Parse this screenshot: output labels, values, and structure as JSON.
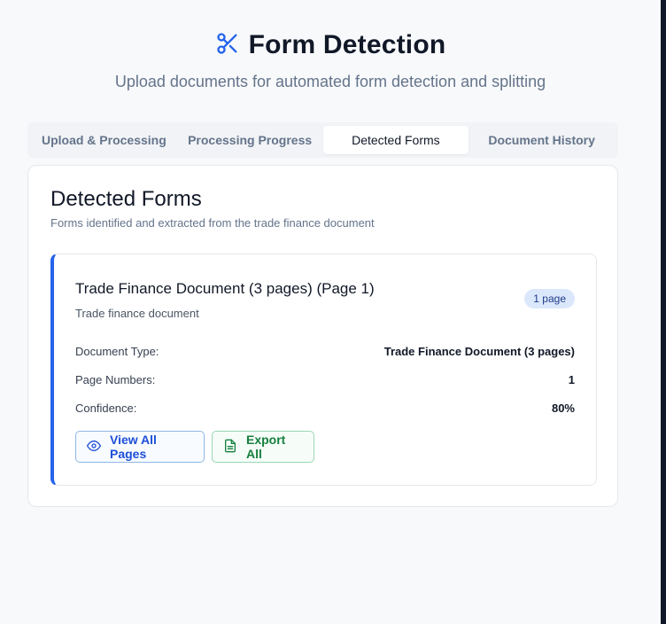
{
  "header": {
    "title": "Form Detection",
    "subtitle": "Upload documents for automated form detection and splitting",
    "icon": "scissors-icon",
    "accent": "#2563eb"
  },
  "tabs": [
    {
      "label": "Upload & Processing",
      "active": false
    },
    {
      "label": "Processing Progress",
      "active": false
    },
    {
      "label": "Detected Forms",
      "active": true
    },
    {
      "label": "Document History",
      "active": false
    }
  ],
  "panel": {
    "title": "Detected Forms",
    "description": "Forms identified and extracted from the trade finance document"
  },
  "form_card": {
    "title": "Trade Finance Document (3 pages) (Page 1)",
    "subtitle": "Trade finance document",
    "badge": "1 page",
    "fields": [
      {
        "label": "Document Type:",
        "value": "Trade Finance Document (3 pages)"
      },
      {
        "label": "Page Numbers:",
        "value": "1"
      },
      {
        "label": "Confidence:",
        "value": "80%"
      }
    ],
    "buttons": {
      "view_label": "View All Pages",
      "view_icon": "eye-icon",
      "export_label": "Export All",
      "export_icon": "file-icon"
    }
  }
}
